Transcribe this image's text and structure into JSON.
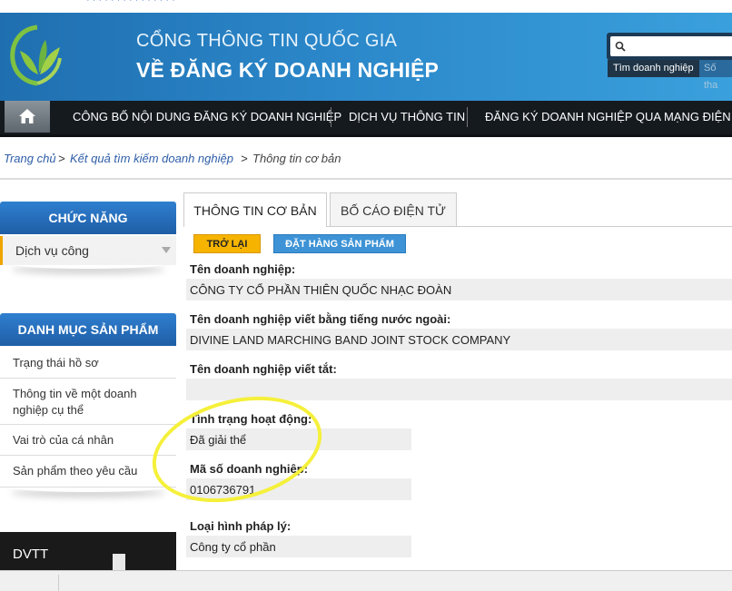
{
  "header": {
    "title_line1": "CỔNG THÔNG TIN QUỐC GIA",
    "title_line2": "VỀ ĐĂNG KÝ DOANH NGHIỆP",
    "search_tab_active": "Tìm doanh nghiệp",
    "search_tab_other": "Số tha"
  },
  "nav": {
    "items": [
      "CÔNG BỐ NỘI DUNG ĐĂNG KÝ DOANH NGHIỆP",
      "DỊCH VỤ THÔNG TIN",
      "ĐĂNG KÝ DOANH NGHIỆP QUA MẠNG ĐIỆN TỬ"
    ]
  },
  "breadcrumb": {
    "home": "Trang chủ",
    "separator": ">",
    "results": "Kết quả tìm kiếm doanh nghiệp",
    "current": "Thông tin cơ bản"
  },
  "sidebar": {
    "function_title": "CHỨC NĂNG",
    "function_item": "Dịch vụ công",
    "catalog_title": "DANH MỤC SẢN PHẨM",
    "catalog_items": [
      "Trạng thái hồ sơ",
      "Thông tin về một doanh nghiệp cụ thể",
      "Vai trò của cá nhân",
      "Sản phẩm theo yêu cầu"
    ],
    "banner": "DVTT"
  },
  "tabs": {
    "basic": "THÔNG TIN CƠ BẢN",
    "report": "BỐ CÁO ĐIỆN TỬ"
  },
  "actions": {
    "back": "TRỞ LẠI",
    "order": "ĐẶT HÀNG SẢN PHẨM"
  },
  "fields": [
    {
      "label": "Tên doanh nghiệp:",
      "value": "CÔNG TY CỔ PHẦN THIÊN QUỐC NHẠC ĐOÀN"
    },
    {
      "label": "Tên doanh nghiệp viết bằng tiếng nước ngoài:",
      "value": "DIVINE LAND MARCHING BAND JOINT STOCK COMPANY"
    },
    {
      "label": "Tên doanh nghiệp viết tắt:",
      "value": ""
    },
    {
      "label": "Tình trạng hoạt động:",
      "value": "Đã giải thể"
    },
    {
      "label": "Mã số doanh nghiệp:",
      "value": "0106736791"
    },
    {
      "label": "Loại hình pháp lý:",
      "value": "Công ty cổ phần"
    }
  ],
  "colors": {
    "header_blue": "#2b87c9",
    "nav_dark": "#151a1f",
    "sidebar_blue": "#1f5ea6",
    "back_button": "#f6b400",
    "order_button": "#3d93d6",
    "highlight": "#f5f03a"
  }
}
